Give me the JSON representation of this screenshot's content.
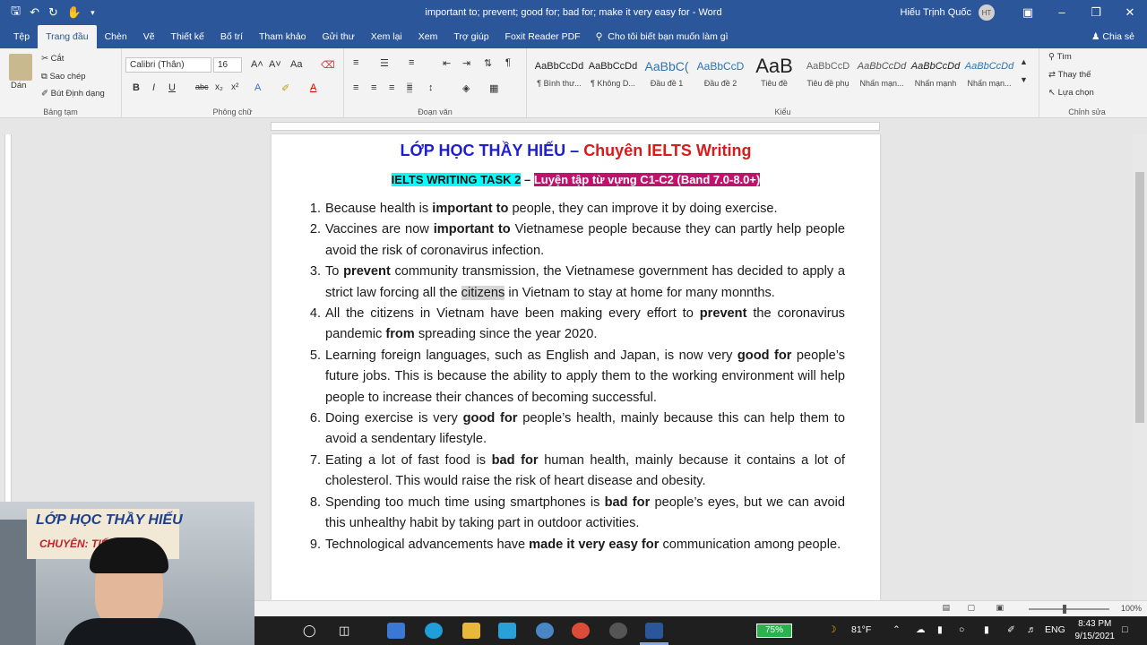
{
  "window": {
    "title": "important to; prevent; good for; bad for; make it very easy for  -  Word",
    "user_name": "Hiếu Trịnh Quốc",
    "user_initials": "HT"
  },
  "tabs": [
    "Tệp",
    "Trang đầu",
    "Chèn",
    "Vẽ",
    "Thiết kế",
    "Bố trí",
    "Tham khảo",
    "Gửi thư",
    "Xem lại",
    "Xem",
    "Trợ giúp",
    "Foxit Reader PDF"
  ],
  "active_tab": "Trang đầu",
  "tell_me": "Cho tôi biết bạn muốn làm gì",
  "share": "Chia sẻ",
  "ribbon": {
    "clipboard": {
      "paste": "Dán",
      "cut": "Cắt",
      "copy": "Sao chép",
      "format_painter": "Bút Định dạng",
      "label": "Bảng tạm"
    },
    "font": {
      "name": "Calibri (Thân)",
      "size": "16",
      "label": "Phông chữ"
    },
    "paragraph": {
      "label": "Đoạn văn"
    },
    "styles": {
      "label": "Kiểu",
      "items": [
        {
          "sample": "AaBbCcDd",
          "name": "¶ Bình thư..."
        },
        {
          "sample": "AaBbCcDd",
          "name": "¶ Không D..."
        },
        {
          "sample": "AaBbC(",
          "name": "Đầu đề 1"
        },
        {
          "sample": "AaBbCcD",
          "name": "Đầu đề 2"
        },
        {
          "sample": "AaB",
          "name": "Tiêu đề"
        },
        {
          "sample": "AaBbCcD",
          "name": "Tiêu đề phụ"
        },
        {
          "sample": "AaBbCcDd",
          "name": "Nhấn mạn..."
        },
        {
          "sample": "AaBbCcDd",
          "name": "Nhấn mạnh"
        },
        {
          "sample": "AaBbCcDd",
          "name": "Nhấn mạn..."
        }
      ]
    },
    "editing": {
      "find": "Tìm",
      "replace": "Thay thế",
      "select": "Lựa chọn",
      "label": "Chỉnh sửa"
    }
  },
  "document": {
    "heading_part1": "LỚP HỌC THẦY HIẾU",
    "heading_dash": " – ",
    "heading_part2": "Chuyên IELTS Writing",
    "subheading_part1": "IELTS WRITING TASK 2",
    "subheading_dash": " – ",
    "subheading_part2": "Luyện tập từ vựng C1-C2 (Band 7.0-8.0+)",
    "items": [
      {
        "n": "1.",
        "t1": "Because health is ",
        "b1": "important to",
        "t2": " people, they can improve it by doing exercise."
      },
      {
        "n": "2.",
        "t1": "Vaccines are now ",
        "b1": "important to",
        "t2": " Vietnamese people because they can partly help people avoid the risk of coronavirus infection."
      },
      {
        "n": "3.",
        "t1": "To ",
        "b1": "prevent",
        "t2": " community transmission, the Vietnamese government has decided to apply a strict law forcing all the ",
        "h": "citizens",
        "t3": " in Vietnam to stay at home for many monnths."
      },
      {
        "n": "4.",
        "t1": "All the citizens in Vietnam have been making every effort to ",
        "b1": "prevent",
        "t2": " the coronavirus pandemic ",
        "b2": "from",
        "t3": " spreading since the year 2020."
      },
      {
        "n": "5.",
        "t1": "Learning foreign languages, such as English and Japan, is now very ",
        "b1": "good for",
        "t2": " people’s future jobs. This is because the ability to apply them to the working environment will help people to increase their chances of becoming successful."
      },
      {
        "n": "6.",
        "t1": "Doing exercise is very ",
        "b1": "good for",
        "t2": " people’s health, mainly because this can help them to avoid a sendentary lifestyle."
      },
      {
        "n": "7.",
        "t1": "Eating a lot of fast food is ",
        "b1": "bad for",
        "t2": " human health, mainly because it contains a lot of cholesterol. This would raise the risk of heart disease and obesity."
      },
      {
        "n": "8.",
        "t1": "Spending too much time using smartphones is ",
        "b1": "bad for",
        "t2": " people’s eyes, but we can avoid this unhealthy habit by taking part in outdoor activities."
      },
      {
        "n": "9.",
        "t1": "Technological advancements have ",
        "b1": "made it very easy for",
        "t2": " communication among people."
      }
    ]
  },
  "statusbar": {
    "zoom": "100%"
  },
  "webcam": {
    "line1": "LỚP HỌC THẦY HIẾU",
    "line2": "CHUYÊN: TIẾ"
  },
  "taskbar": {
    "battery": "75%",
    "weather": "81°F",
    "language": "ENG",
    "time": "8:43 PM",
    "date": "9/15/2021"
  },
  "colors": {
    "word_blue": "#2b579a",
    "heading_blue": "#1f1fcf",
    "heading_red": "#d81b1b",
    "highlight_cyan": "#00ffff",
    "highlight_magenta": "#c0116c"
  }
}
